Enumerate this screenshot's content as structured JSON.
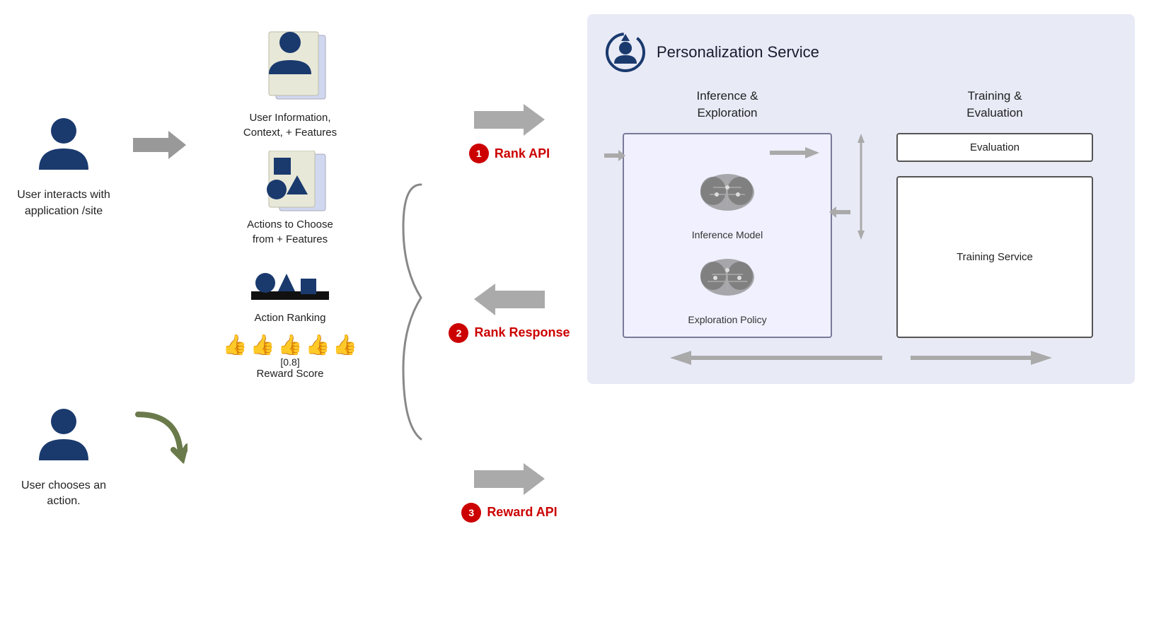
{
  "left": {
    "user1_label": "User interacts with\napplication /site",
    "user2_label": "User chooses an\naction.",
    "arrow_right_label": "right-arrow",
    "curved_arrow_label": "curved-arrow"
  },
  "mid": {
    "features_label": "User Information,\nContext,  + Features",
    "actions_label": "Actions to Choose\nfrom + Features",
    "ranking_label": "Action Ranking",
    "reward_score_value": "[0.8]",
    "reward_label": "Reward Score"
  },
  "api": {
    "rank_api_number": "1",
    "rank_api_text": "Rank API",
    "rank_response_number": "2",
    "rank_response_text": "Rank Response",
    "reward_api_number": "3",
    "reward_api_text": "Reward API"
  },
  "personalization": {
    "title": "Personalization Service",
    "inference_title": "Inference &\nExploration",
    "training_title": "Training &\nEvaluation",
    "inference_model_label": "Inference Model",
    "exploration_policy_label": "Exploration Policy",
    "evaluation_label": "Evaluation",
    "training_service_label": "Training Service"
  }
}
